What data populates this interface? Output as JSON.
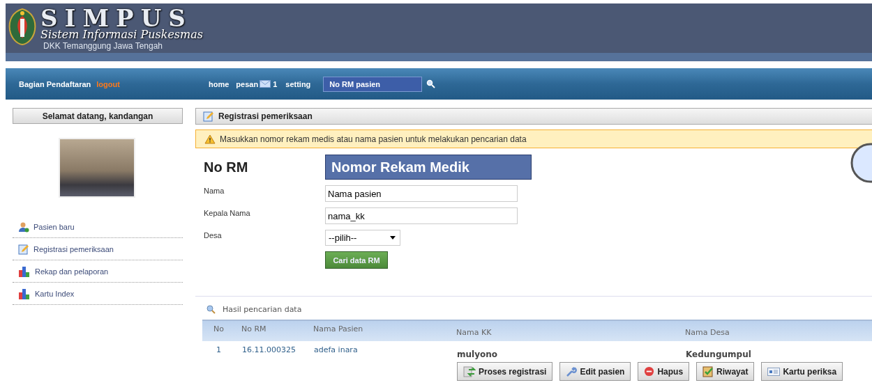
{
  "header": {
    "title": "SIMPUS",
    "subtitle": "Sistem Informasi Puskesmas",
    "region": "DKK Temanggung Jawa Tengah"
  },
  "navbar": {
    "role": "Bagian Pendaftaran",
    "logout": "logout",
    "links": [
      {
        "label": "home",
        "kind": "text"
      },
      {
        "label": "pesan",
        "kind": "mail",
        "count": "1"
      },
      {
        "label": "setting",
        "kind": "text"
      }
    ],
    "search": {
      "placeholder": "No RM pasien"
    }
  },
  "sidebar": {
    "welcome": "Selamat datang, kandangan",
    "items": [
      {
        "label": "Pasien baru",
        "kind": "user"
      },
      {
        "label": "Registrasi pemeriksaan",
        "kind": "edit"
      },
      {
        "label": "Rekap dan pelaporan",
        "kind": "chart"
      },
      {
        "label": "Kartu Index",
        "kind": "chart"
      }
    ]
  },
  "panel": {
    "title": "Registrasi pemeriksaan",
    "alert": "Masukkan nomor rekam medis atau nama pasien untuk melakukan pencarian data",
    "form": {
      "rm_label": "No RM",
      "rm_value": "Nomor Rekam Medik",
      "fields": [
        {
          "label": "Nama",
          "kind": "text",
          "value": "Nama pasien"
        },
        {
          "label": "Kepala Nama",
          "kind": "text",
          "value": "nama_kk"
        },
        {
          "label": "Desa",
          "kind": "select",
          "value": "--pilih--"
        }
      ],
      "submit": "Cari data RM"
    }
  },
  "results": {
    "title": "Hasil pencarian data",
    "columns": [
      "No",
      "No RM",
      "Nama Pasien",
      "Nama KK",
      "Nama Desa"
    ],
    "rows": [
      {
        "no": "1",
        "rm": "16.11.000325",
        "nama": "adefa inara",
        "kk": "mulyono",
        "desa": "Kedungumpul",
        "actions": [
          {
            "label": "Proses registrasi",
            "kind": "refresh"
          },
          {
            "label": "Edit pasien",
            "kind": "wrench"
          },
          {
            "label": "Hapus",
            "kind": "delete"
          },
          {
            "label": "Riwayat",
            "kind": "clipboard"
          },
          {
            "label": "Kartu periksa",
            "kind": "card"
          }
        ]
      }
    ]
  }
}
